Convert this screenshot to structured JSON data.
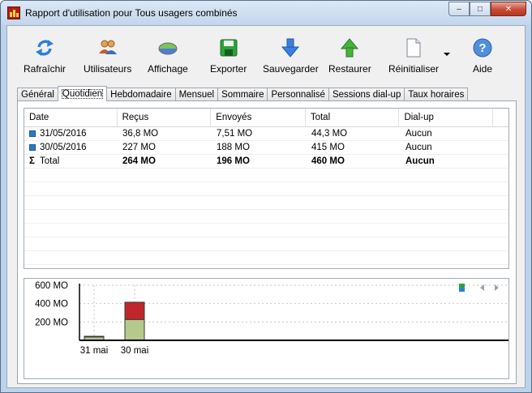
{
  "window": {
    "title": "Rapport d'utilisation pour Tous usagers combinés",
    "minimize": "–",
    "maximize": "□",
    "close": "✕"
  },
  "toolbar": {
    "buttons": [
      {
        "label": "Rafraîchir",
        "icon": "refresh-icon"
      },
      {
        "label": "Utilisateurs",
        "icon": "users-icon"
      },
      {
        "label": "Affichage",
        "icon": "view-icon"
      },
      {
        "label": "Exporter",
        "icon": "save-disk-icon"
      },
      {
        "label": "Sauvegarder",
        "icon": "arrow-down-icon"
      },
      {
        "label": "Restaurer",
        "icon": "arrow-up-icon"
      },
      {
        "label": "Réinitialiser",
        "icon": "document-icon"
      },
      {
        "label": "Aide",
        "icon": "help-icon"
      }
    ]
  },
  "tabs": [
    {
      "label": "Général",
      "active": false
    },
    {
      "label": "Quotidien",
      "active": true
    },
    {
      "label": "Hebdomadaire",
      "active": false
    },
    {
      "label": "Mensuel",
      "active": false
    },
    {
      "label": "Sommaire",
      "active": false
    },
    {
      "label": "Personnalisé",
      "active": false
    },
    {
      "label": "Sessions dial-up",
      "active": false
    },
    {
      "label": "Taux horaires",
      "active": false
    }
  ],
  "table": {
    "columns": [
      "Date",
      "Reçus",
      "Envoyés",
      "Total",
      "Dial-up"
    ],
    "rows": [
      [
        "31/05/2016",
        "36,8 MO",
        "7,51 MO",
        "44,3 MO",
        "Aucun"
      ],
      [
        "30/05/2016",
        "227 MO",
        "188 MO",
        "415 MO",
        "Aucun"
      ]
    ],
    "total_row": [
      "Total",
      "264 MO",
      "196 MO",
      "460 MO",
      "Aucun"
    ]
  },
  "colors": {
    "received": "#b5c98a",
    "sent": "#c0262b",
    "row_bullet": "#2a7ac3"
  },
  "chart_data": {
    "type": "bar",
    "stacked": true,
    "categories": [
      "31 mai",
      "30 mai"
    ],
    "series": [
      {
        "values": [
          36.8,
          227
        ]
      },
      {
        "values": [
          7.51,
          188
        ]
      }
    ],
    "yticks": [
      "200 MO",
      "400 MO",
      "600 MO"
    ],
    "ytick_values": [
      200,
      400,
      600
    ],
    "ylim": [
      0,
      600
    ],
    "grid": true
  }
}
